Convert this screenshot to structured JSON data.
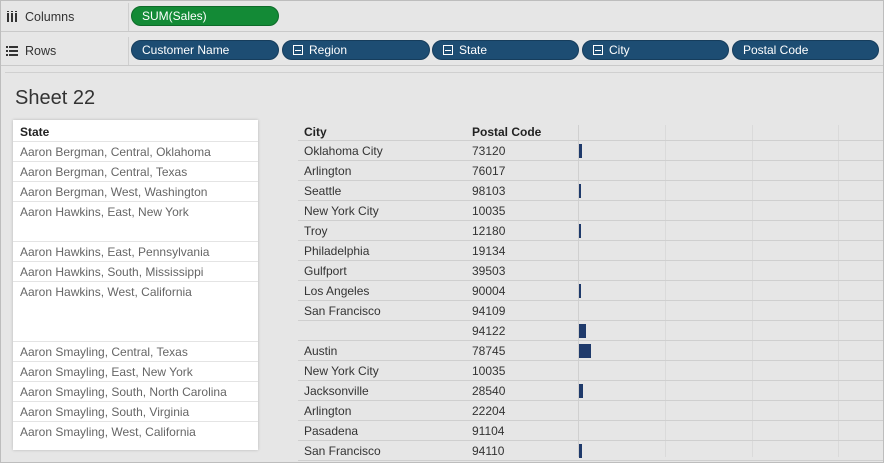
{
  "shelves": {
    "columns": {
      "label": "Columns",
      "pills": [
        {
          "text": "SUM(Sales)",
          "color": "#138a36"
        }
      ]
    },
    "rows": {
      "label": "Rows",
      "pills": [
        {
          "text": "Customer Name",
          "minus": false
        },
        {
          "text": "Region",
          "minus": true
        },
        {
          "text": "State",
          "minus": true
        },
        {
          "text": "City",
          "minus": true
        },
        {
          "text": "Postal Code",
          "minus": false
        }
      ],
      "color": "#1d4d73"
    }
  },
  "sheet": {
    "title": "Sheet 22",
    "headers": {
      "state": "State",
      "city": "City",
      "postal": "Postal Code"
    },
    "state_groups": [
      "Aaron Bergman, Central, Oklahoma",
      "Aaron Bergman, Central, Texas",
      "Aaron Bergman, West, Washington",
      "Aaron Hawkins, East, New York",
      "Aaron Hawkins, East, Pennsylvania",
      "Aaron Hawkins, South, Mississippi",
      "Aaron Hawkins, West, California",
      "Aaron Smayling, Central, Texas",
      "Aaron Smayling, East, New York",
      "Aaron Smayling, South, North Carolina",
      "Aaron Smayling, South, Virginia",
      "Aaron Smayling, West, California"
    ],
    "rows": [
      {
        "city": "Oklahoma City",
        "postal": "73120",
        "sales_rel": 0.25
      },
      {
        "city": "Arlington",
        "postal": "76017",
        "sales_rel": 0.0
      },
      {
        "city": "Seattle",
        "postal": "98103",
        "sales_rel": 0.15
      },
      {
        "city": "New York City",
        "postal": "10035",
        "sales_rel": 0.0
      },
      {
        "city": "Troy",
        "postal": "12180",
        "sales_rel": 0.08
      },
      {
        "city": "Philadelphia",
        "postal": "19134",
        "sales_rel": 0.0
      },
      {
        "city": "Gulfport",
        "postal": "39503",
        "sales_rel": 0.0
      },
      {
        "city": "Los Angeles",
        "postal": "90004",
        "sales_rel": 0.12
      },
      {
        "city": "San Francisco",
        "postal": "94109",
        "sales_rel": 0.0
      },
      {
        "city": "",
        "postal": "94122",
        "sales_rel": 0.55
      },
      {
        "city": "Austin",
        "postal": "78745",
        "sales_rel": 1.0
      },
      {
        "city": "New York City",
        "postal": "10035",
        "sales_rel": 0.0
      },
      {
        "city": "Jacksonville",
        "postal": "28540",
        "sales_rel": 0.3
      },
      {
        "city": "Arlington",
        "postal": "22204",
        "sales_rel": 0.0
      },
      {
        "city": "Pasadena",
        "postal": "91104",
        "sales_rel": 0.0
      },
      {
        "city": "San Francisco",
        "postal": "94110",
        "sales_rel": 0.25
      }
    ]
  },
  "colors": {
    "bar": "#1f3a6b",
    "canvas": "#e6e6e6"
  }
}
